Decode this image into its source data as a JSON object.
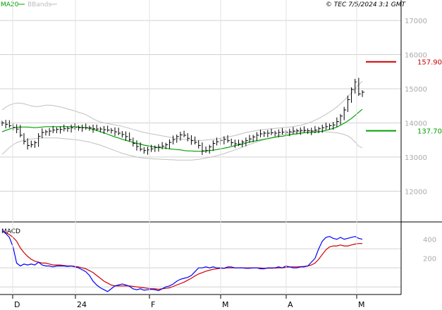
{
  "header": {
    "legend": [
      {
        "label": "MA20",
        "color": "#00a000"
      },
      {
        "label": "BBands",
        "color": "#bbbbbb"
      }
    ],
    "copyright": "© TEC 7/5/2024 3:1 GMT"
  },
  "colors": {
    "price": "#000000",
    "ma20": "#00a000",
    "bbands": "#c0c0c0",
    "grid": "#d0d0d0",
    "macd": "#0000ff",
    "signal": "#cc0000",
    "resistance": "#cc0000",
    "support": "#00a000"
  },
  "chart_data": [
    {
      "type": "bar",
      "title": "",
      "x_tick_labels": [
        "D",
        "24",
        "F",
        "M",
        "A",
        "M"
      ],
      "y_tick_labels": [
        "17000",
        "16000",
        "15000",
        "14000",
        "13000",
        "12000"
      ],
      "ylim": [
        11100,
        17600
      ],
      "grid": true,
      "series": [
        {
          "name": "MA20",
          "values": [
            13740,
            13780,
            13820,
            13850,
            13870,
            13880,
            13880,
            13880,
            13870,
            13860,
            13870,
            13880,
            13890,
            13890,
            13890,
            13890,
            13890,
            13890,
            13890,
            13890,
            13890,
            13880,
            13870,
            13860,
            13840,
            13810,
            13780,
            13740,
            13710,
            13670,
            13630,
            13590,
            13560,
            13520,
            13490,
            13460,
            13430,
            13400,
            13380,
            13350,
            13330,
            13310,
            13290,
            13280,
            13270,
            13260,
            13240,
            13230,
            13220,
            13210,
            13190,
            13180,
            13180,
            13170,
            13170,
            13170,
            13180,
            13190,
            13200,
            13220,
            13240,
            13260,
            13280,
            13310,
            13330,
            13360,
            13380,
            13410,
            13440,
            13460,
            13480,
            13500,
            13520,
            13540,
            13560,
            13580,
            13600,
            13610,
            13630,
            13650,
            13670,
            13680,
            13700,
            13710,
            13720,
            13720,
            13730,
            13740,
            13760,
            13780,
            13810,
            13840,
            13880,
            13930,
            13990,
            14060,
            14130,
            14220,
            14310,
            14400
          ]
        },
        {
          "name": "BBands-upper",
          "values": [
            14380,
            14460,
            14520,
            14560,
            14580,
            14580,
            14560,
            14530,
            14500,
            14480,
            14480,
            14500,
            14520,
            14520,
            14510,
            14490,
            14470,
            14440,
            14410,
            14380,
            14350,
            14310,
            14280,
            14240,
            14180,
            14120,
            14070,
            14030,
            14000,
            13980,
            13960,
            13940,
            13920,
            13900,
            13870,
            13840,
            13810,
            13780,
            13750,
            13720,
            13700,
            13680,
            13660,
            13640,
            13620,
            13600,
            13580,
            13560,
            13540,
            13530,
            13520,
            13510,
            13500,
            13490,
            13490,
            13490,
            13500,
            13510,
            13520,
            13530,
            13550,
            13570,
            13590,
            13610,
            13630,
            13660,
            13690,
            13720,
            13740,
            13760,
            13780,
            13800,
            13810,
            13820,
            13830,
            13840,
            13850,
            13860,
            13870,
            13880,
            13890,
            13910,
            13930,
            13960,
            13990,
            14030,
            14080,
            14130,
            14190,
            14250,
            14320,
            14390,
            14470,
            14560,
            14660,
            14770,
            14880,
            15000,
            15120,
            15220
          ]
        },
        {
          "name": "BBands-lower",
          "values": [
            13080,
            13180,
            13280,
            13360,
            13420,
            13460,
            13490,
            13510,
            13530,
            13540,
            13550,
            13560,
            13560,
            13560,
            13560,
            13560,
            13550,
            13540,
            13530,
            13520,
            13510,
            13500,
            13480,
            13460,
            13440,
            13410,
            13380,
            13350,
            13310,
            13270,
            13230,
            13190,
            13150,
            13110,
            13080,
            13050,
            13030,
            13000,
            12980,
            12970,
            12960,
            12950,
            12940,
            12940,
            12930,
            12930,
            12920,
            12920,
            12910,
            12910,
            12910,
            12910,
            12910,
            12920,
            12930,
            12950,
            12970,
            12990,
            13010,
            13040,
            13070,
            13100,
            13140,
            13170,
            13210,
            13250,
            13290,
            13330,
            13370,
            13410,
            13440,
            13480,
            13510,
            13540,
            13570,
            13600,
            13630,
            13660,
            13680,
            13700,
            13720,
            13740,
            13750,
            13760,
            13770,
            13770,
            13770,
            13760,
            13750,
            13740,
            13730,
            13720,
            13710,
            13690,
            13660,
            13620,
            13550,
            13440,
            13320,
            13270
          ]
        },
        {
          "name": "Price",
          "values": [
            14000,
            13960,
            13920,
            13870,
            13820,
            13640,
            13460,
            13340,
            13360,
            13420,
            13610,
            13720,
            13740,
            13760,
            13790,
            13810,
            13810,
            13830,
            13840,
            13860,
            13870,
            13860,
            13860,
            13860,
            13860,
            13830,
            13820,
            13820,
            13800,
            13790,
            13780,
            13740,
            13700,
            13660,
            13600,
            13510,
            13400,
            13310,
            13230,
            13190,
            13210,
            13240,
            13280,
            13290,
            13320,
            13360,
            13430,
            13510,
            13600,
            13650,
            13640,
            13550,
            13480,
            13430,
            13340,
            13180,
            13190,
            13300,
            13400,
            13450,
            13490,
            13520,
            13480,
            13420,
            13390,
            13380,
            13440,
            13480,
            13530,
            13590,
            13640,
            13680,
            13700,
            13700,
            13710,
            13700,
            13720,
            13730,
            13730,
            13740,
            13760,
            13770,
            13780,
            13780,
            13770,
            13760,
            13790,
            13830,
            13860,
            13890,
            13920,
            13940,
            14040,
            14200,
            14380,
            14680,
            14980,
            15200,
            14850,
            14900
          ]
        }
      ],
      "annotations": [
        {
          "label": "157.90",
          "value": 15790,
          "color": "#cc0000"
        },
        {
          "label": "137.70",
          "value": 13770,
          "color": "#00a000"
        }
      ]
    },
    {
      "type": "line",
      "title": "MACD",
      "y_tick_labels": [
        "400",
        "200"
      ],
      "ylim": [
        -180,
        560
      ],
      "series": [
        {
          "name": "MACD",
          "values": [
            490,
            460,
            420,
            320,
            150,
            120,
            140,
            130,
            140,
            130,
            160,
            130,
            120,
            120,
            110,
            120,
            120,
            120,
            115,
            120,
            110,
            100,
            80,
            60,
            20,
            -40,
            -80,
            -110,
            -130,
            -150,
            -120,
            -90,
            -80,
            -70,
            -80,
            -95,
            -120,
            -130,
            -120,
            -135,
            -130,
            -125,
            -130,
            -140,
            -120,
            -100,
            -90,
            -70,
            -40,
            -20,
            -10,
            0,
            20,
            60,
            100,
            100,
            110,
            100,
            110,
            100,
            100,
            95,
            110,
            110,
            100,
            100,
            100,
            95,
            95,
            100,
            100,
            90,
            90,
            100,
            100,
            100,
            110,
            100,
            120,
            110,
            100,
            100,
            110,
            110,
            120,
            160,
            200,
            300,
            380,
            420,
            430,
            410,
            400,
            420,
            400,
            410,
            420,
            430,
            410,
            400
          ]
        },
        {
          "name": "Signal",
          "values": [
            480,
            470,
            450,
            420,
            380,
            310,
            260,
            220,
            190,
            170,
            160,
            150,
            150,
            140,
            130,
            130,
            130,
            125,
            120,
            120,
            115,
            110,
            100,
            90,
            70,
            50,
            20,
            -10,
            -40,
            -60,
            -80,
            -90,
            -90,
            -90,
            -90,
            -90,
            -95,
            -100,
            -105,
            -110,
            -115,
            -120,
            -120,
            -125,
            -120,
            -115,
            -110,
            -95,
            -80,
            -65,
            -50,
            -30,
            -10,
            15,
            35,
            50,
            65,
            75,
            85,
            90,
            95,
            95,
            100,
            100,
            100,
            100,
            100,
            100,
            100,
            100,
            100,
            98,
            95,
            96,
            97,
            98,
            100,
            100,
            105,
            110,
            110,
            110,
            112,
            115,
            120,
            130,
            150,
            190,
            240,
            290,
            320,
            330,
            330,
            340,
            330,
            330,
            340,
            350,
            355,
            355
          ]
        }
      ]
    }
  ]
}
